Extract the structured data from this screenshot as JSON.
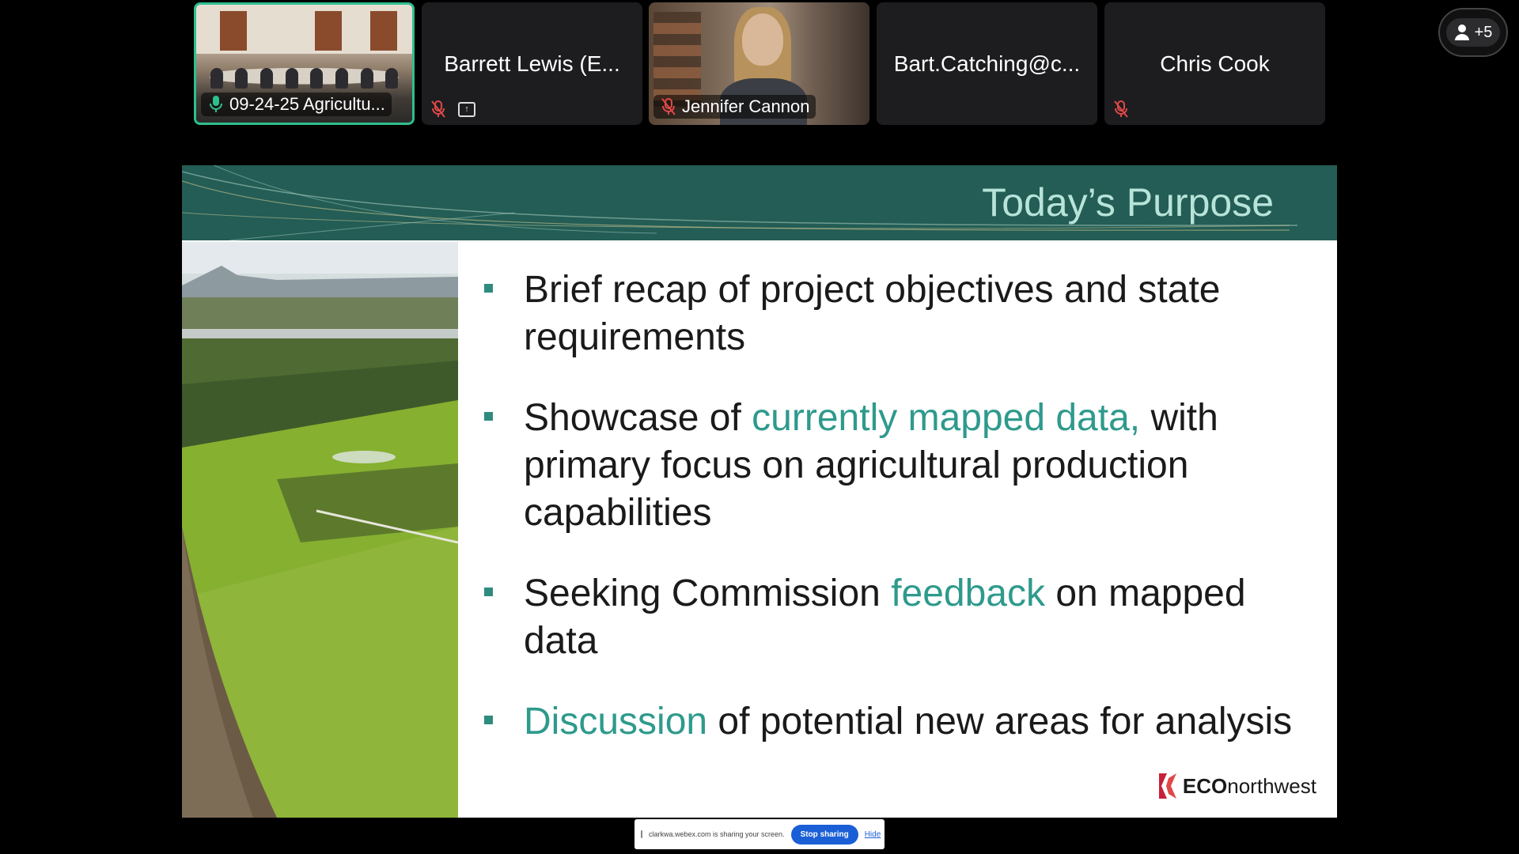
{
  "participants": [
    {
      "name": "09-24-25 Agricultu...",
      "active": true,
      "video": "conference-room"
    },
    {
      "name": "Barrett Lewis (E...",
      "muted": true,
      "sharing": true
    },
    {
      "name": "Jennifer Cannon",
      "muted": true,
      "video": "person"
    },
    {
      "name": "Bart.Catching@c..."
    },
    {
      "name": "Chris Cook",
      "muted": true
    }
  ],
  "more_participants": {
    "label": "+5",
    "icon": "person-icon"
  },
  "slide": {
    "title": "Today’s Purpose",
    "bullets": [
      {
        "parts": [
          {
            "text": "Brief recap of project objectives and state requirements",
            "highlight": false
          }
        ]
      },
      {
        "parts": [
          {
            "text": "Showcase of ",
            "highlight": false
          },
          {
            "text": "currently mapped data,",
            "highlight": true
          },
          {
            "text": " with primary focus on agricultural production capabilities",
            "highlight": false
          }
        ]
      },
      {
        "parts": [
          {
            "text": "Seeking Commission ",
            "highlight": false
          },
          {
            "text": "feedback",
            "highlight": true
          },
          {
            "text": " on mapped data",
            "highlight": false
          }
        ]
      },
      {
        "parts": [
          {
            "text": "Discussion",
            "highlight": true
          },
          {
            "text": " of potential new areas for analysis",
            "highlight": false
          }
        ]
      }
    ],
    "brand": {
      "bold": "ECO",
      "rest": "northwest"
    }
  },
  "share_bar": {
    "message": "clarkwa.webex.com is sharing your screen.",
    "stop_label": "Stop sharing",
    "hide_label": "Hide"
  },
  "colors": {
    "accent": "#2fbf8f",
    "header": "#235d55",
    "title": "#b7e3d9",
    "highlight": "#2e9a8c",
    "stop_button": "#1b5fd6"
  }
}
